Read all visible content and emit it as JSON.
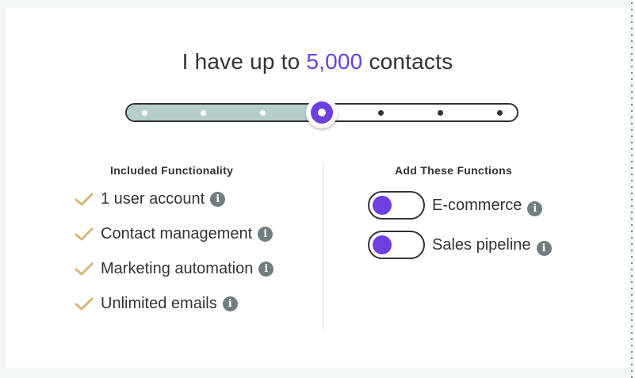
{
  "headline": {
    "prefix": "I have up to",
    "count": "5,000",
    "suffix": "contacts"
  },
  "slider": {
    "stops": 7,
    "selected_index": 3,
    "fill_color": "#b5cdcb",
    "accent_color": "#6b3fe0"
  },
  "included": {
    "heading": "Included Functionality",
    "items": [
      {
        "label": "1 user account",
        "icon": "info-icon"
      },
      {
        "label": "Contact management",
        "icon": "info-icon"
      },
      {
        "label": "Marketing automation",
        "icon": "info-icon"
      },
      {
        "label": "Unlimited emails",
        "icon": "info-icon"
      }
    ],
    "check_color": "#d7b57a"
  },
  "add_functions": {
    "heading": "Add These Functions",
    "items": [
      {
        "label": "E-commerce",
        "enabled": false,
        "icon": "info-icon"
      },
      {
        "label": "Sales pipeline",
        "enabled": false,
        "icon": "info-icon"
      }
    ]
  },
  "info_glyph": "i"
}
